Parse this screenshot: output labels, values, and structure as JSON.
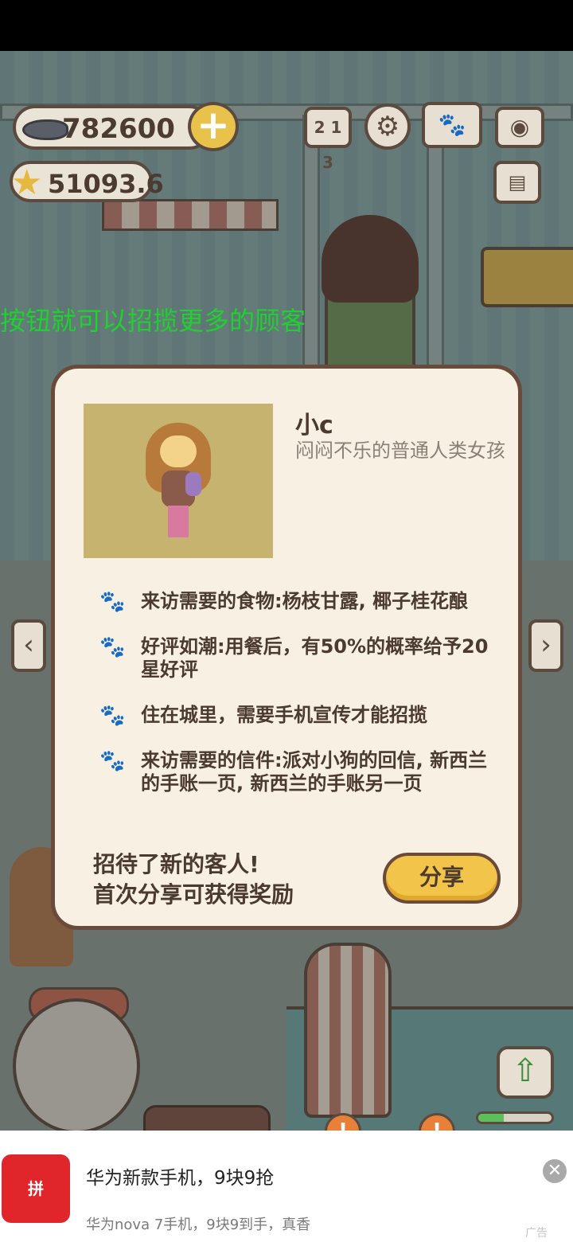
{
  "hud": {
    "fish_currency": "782600",
    "star_currency": "51093.6",
    "add_currency_icon": "plus-icon",
    "top_icons": [
      "ranking-icon",
      "gear-icon",
      "paw-book-icon",
      "camera-icon",
      "postcard-icon"
    ],
    "rank_glyph": "2 1 3"
  },
  "scroll_message": "按钮就可以招揽更多的顾客",
  "customer_card": {
    "name": "小c",
    "description": "闷闷不乐的普通人类女孩",
    "traits": [
      "来访需要的食物:杨枝甘露, 椰子桂花酿",
      "好评如潮:用餐后，有50%的概率给予20星好评",
      "住在城里，需要手机宣传才能招揽",
      "来访需要的信件:派对小狗的回信, 新西兰的手账一页, 新西兰的手账另一页"
    ],
    "footer_line1": "招待了新的客人!",
    "footer_line2": "首次分享可获得奖励",
    "share_label": "分享"
  },
  "shop": {
    "upgrade_progress": 0.35
  },
  "ad": {
    "logo_text": "拼",
    "title": "华为新款手机，9块9抢",
    "subtitle": "华为nova 7手机，9块9到手，真香",
    "tag": "广告"
  },
  "colors": {
    "modal_bg": "#f8f0e2",
    "share_button": "#f3c44a",
    "scroll_text": "#1ed12e",
    "ad_logo": "#e0262b"
  }
}
